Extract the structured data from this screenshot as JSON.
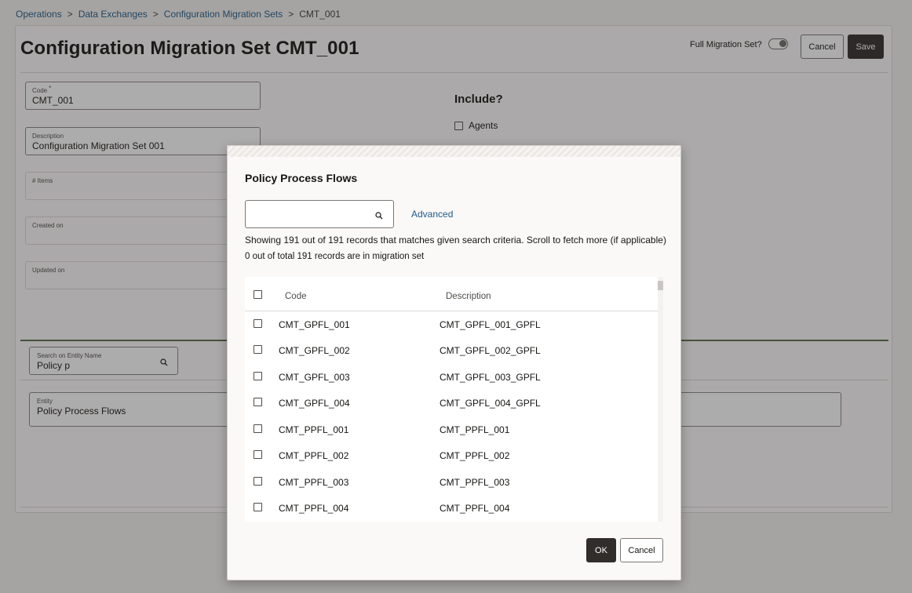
{
  "breadcrumb": {
    "items": [
      "Operations",
      "Data Exchanges",
      "Configuration Migration Sets"
    ],
    "current": "CMT_001",
    "separator": ">"
  },
  "page": {
    "title": "Configuration Migration Set CMT_001",
    "full_migration_label": "Full Migration Set?",
    "cancel_label": "Cancel",
    "save_label": "Save"
  },
  "form": {
    "code": {
      "label": "Code",
      "required_mark": "*",
      "value": "CMT_001"
    },
    "description": {
      "label": "Description",
      "value": "Configuration Migration Set 001"
    },
    "items": {
      "label": "# Items",
      "value": ""
    },
    "created_on": {
      "label": "Created on",
      "value": ""
    },
    "updated_on": {
      "label": "Updated on",
      "value": ""
    }
  },
  "include": {
    "title": "Include?",
    "agents_label": "Agents"
  },
  "entity_search": {
    "label": "Search on Entity Name",
    "value": "Policy p"
  },
  "entity": {
    "label": "Entity",
    "value": "Policy Process Flows"
  },
  "dialog": {
    "title": "Policy Process Flows",
    "search_placeholder": "",
    "advanced_label": "Advanced",
    "info_showing": "Showing 191 out of 191 records that matches given search criteria. Scroll to fetch more (if applicable)",
    "info_in_set": "0 out of total 191 records are in migration set",
    "columns": {
      "code": "Code",
      "description": "Description"
    },
    "rows": [
      {
        "code": "CMT_GPFL_001",
        "description": "CMT_GPFL_001_GPFL"
      },
      {
        "code": "CMT_GPFL_002",
        "description": "CMT_GPFL_002_GPFL"
      },
      {
        "code": "CMT_GPFL_003",
        "description": "CMT_GPFL_003_GPFL"
      },
      {
        "code": "CMT_GPFL_004",
        "description": "CMT_GPFL_004_GPFL"
      },
      {
        "code": "CMT_PPFL_001",
        "description": "CMT_PPFL_001"
      },
      {
        "code": "CMT_PPFL_002",
        "description": "CMT_PPFL_002"
      },
      {
        "code": "CMT_PPFL_003",
        "description": "CMT_PPFL_003"
      },
      {
        "code": "CMT_PPFL_004",
        "description": "CMT_PPFL_004"
      }
    ],
    "ok_label": "OK",
    "cancel_label": "Cancel"
  },
  "icons": {
    "search": "search-icon",
    "toggle": "toggle-switch",
    "checkbox": "checkbox-icon"
  },
  "colors": {
    "link": "#1d5a88",
    "primary_button": "#312d2a",
    "divider_accent": "#5b6d4a"
  }
}
